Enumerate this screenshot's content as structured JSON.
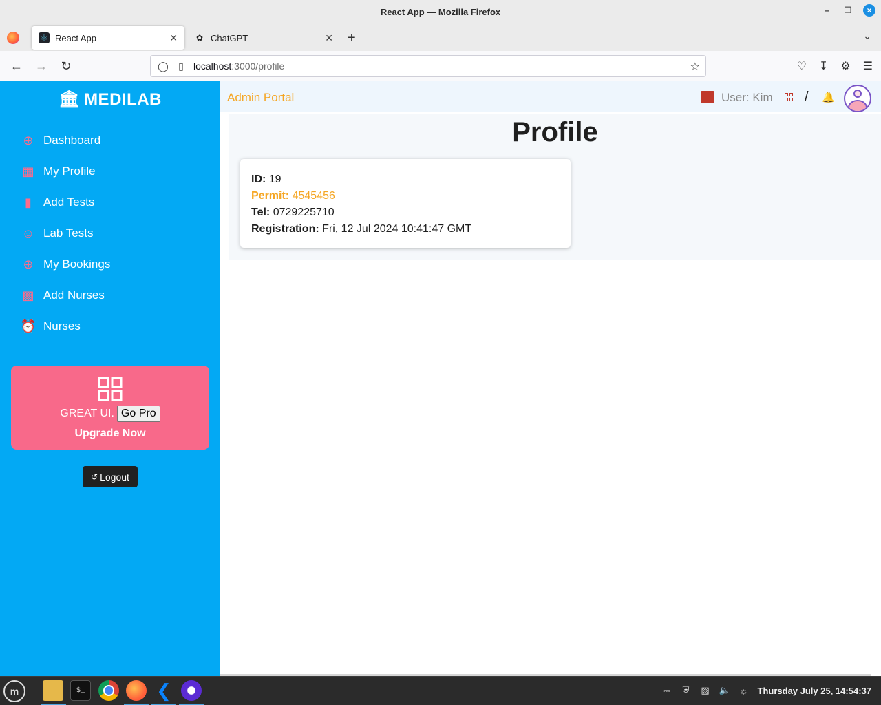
{
  "window": {
    "title": "React App — Mozilla Firefox"
  },
  "tabs": [
    {
      "label": "React App",
      "active": true
    },
    {
      "label": "ChatGPT",
      "active": false
    }
  ],
  "url": {
    "host": "localhost",
    "path": ":3000/profile"
  },
  "sidebar": {
    "brand": "MEDILAB",
    "items": [
      {
        "label": "Dashboard",
        "icon": "plus-circle-icon"
      },
      {
        "label": "My Profile",
        "icon": "grid-icon"
      },
      {
        "label": "Add Tests",
        "icon": "book-icon"
      },
      {
        "label": "Lab Tests",
        "icon": "person-icon"
      },
      {
        "label": "My Bookings",
        "icon": "plus-circle-icon"
      },
      {
        "label": "Add Nurses",
        "icon": "gift-icon"
      },
      {
        "label": "Nurses",
        "icon": "alarm-icon"
      }
    ],
    "promo": {
      "text": "GREAT UI.",
      "button": "Go Pro",
      "cta": "Upgrade Now"
    },
    "logout": "Logout"
  },
  "topbar": {
    "title": "Admin Portal",
    "user": "User: Kim",
    "separator": "/"
  },
  "profile": {
    "title": "Profile",
    "id_label": "ID:",
    "id_value": "19",
    "permit_label": "Permit:",
    "permit_value": "4545456",
    "tel_label": "Tel:",
    "tel_value": "0729225710",
    "reg_label": "Registration:",
    "reg_value": "Fri, 12 Jul 2024 10:41:47 GMT"
  },
  "taskbar": {
    "clock": "Thursday July 25, 14:54:37"
  },
  "colors": {
    "sidebar": "#03a9f4",
    "accent_pink": "#f8698a",
    "portal_orange": "#f5a623",
    "icon_red": "#c0392b"
  }
}
